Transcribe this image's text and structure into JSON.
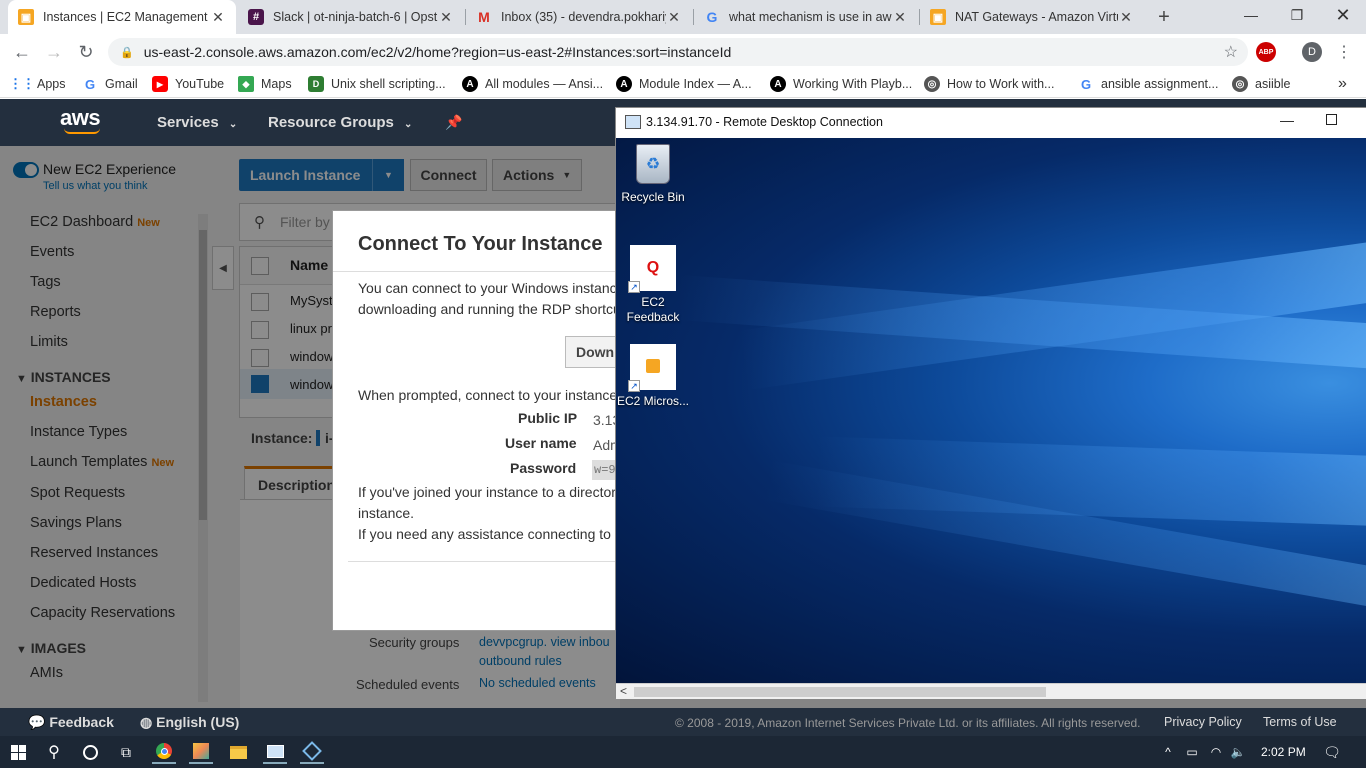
{
  "browser": {
    "tabs": [
      {
        "title": "Instances | EC2 Management C",
        "active": true
      },
      {
        "title": "Slack | ot-ninja-batch-6 | Opst",
        "active": false
      },
      {
        "title": "Inbox (35) - devendra.pokhariy",
        "active": false
      },
      {
        "title": "what mechanism is use in aws",
        "active": false
      },
      {
        "title": "NAT Gateways - Amazon Virtu",
        "active": false
      }
    ],
    "new_tab": "+",
    "url": "us-east-2.console.aws.amazon.com/ec2/v2/home?region=us-east-2#Instances:sort=instanceId",
    "profile_initial": "D",
    "abp": "ABP",
    "bookmarks": [
      "Apps",
      "Gmail",
      "YouTube",
      "Maps",
      "Unix shell scripting...",
      "All modules — Ansi...",
      "Module Index — A...",
      "Working With Playb...",
      "How to Work with...",
      "ansible assignment...",
      "asiible"
    ],
    "more": "»"
  },
  "aws": {
    "logo": "aws",
    "nav": {
      "services": "Services",
      "resource_groups": "Resource Groups"
    },
    "toggle": {
      "label": "New EC2 Experience",
      "sub": "Tell us what you think"
    },
    "sidebar": [
      {
        "label": "EC2 Dashboard",
        "badge": "New"
      },
      {
        "label": "Events"
      },
      {
        "label": "Tags"
      },
      {
        "label": "Reports"
      },
      {
        "label": "Limits"
      }
    ],
    "section_instances": "INSTANCES",
    "instances_items": [
      {
        "label": "Instances",
        "active": true
      },
      {
        "label": "Instance Types"
      },
      {
        "label": "Launch Templates",
        "badge": "New"
      },
      {
        "label": "Spot Requests"
      },
      {
        "label": "Savings Plans"
      },
      {
        "label": "Reserved Instances"
      },
      {
        "label": "Dedicated Hosts"
      },
      {
        "label": "Capacity Reservations"
      }
    ],
    "section_images": "IMAGES",
    "images_items": [
      "AMIs"
    ],
    "toolbar": {
      "launch": "Launch Instance",
      "connect": "Connect",
      "actions": "Actions"
    },
    "filter_placeholder": "Filter by t",
    "table": {
      "header": "Name",
      "rows": [
        "MySyst",
        "linux pr",
        "window",
        "window"
      ]
    },
    "instance_label": "Instance:",
    "instance_value": "i-",
    "tab_description": "Description",
    "details": [
      {
        "key": "Security groups",
        "value": "devvpcgrup. view inbou",
        "value2": "outbound rules"
      },
      {
        "key": "Scheduled events",
        "value": "No scheduled events"
      }
    ],
    "footer": {
      "feedback": "Feedback",
      "language": "English (US)",
      "copyright": "© 2008 - 2019, Amazon Internet Services Private Ltd. or its affiliates. All rights reserved.",
      "privacy": "Privacy Policy",
      "terms": "Terms of Use"
    }
  },
  "modal": {
    "title": "Connect To Your Instance",
    "intro1": "You can connect to your Windows instanc",
    "intro2": "downloading and running the RDP shortcu",
    "download_button": "Down",
    "prompt": "When prompted, connect to your instance",
    "fields": [
      {
        "label": "Public IP",
        "value": "3.13"
      },
      {
        "label": "User name",
        "value": "Adm"
      },
      {
        "label": "Password",
        "value": "w=9"
      }
    ],
    "note1": "If you've joined your instance to a director",
    "note2": "instance.",
    "note3": "If you need any assistance connecting to"
  },
  "rdp": {
    "title": "3.134.91.70 - Remote Desktop Connection",
    "icons": [
      {
        "label": "Recycle Bin"
      },
      {
        "label": "EC2 Feedback",
        "glyph": "Q"
      },
      {
        "label": "EC2 Micros..."
      }
    ],
    "scroll_left": "<"
  },
  "taskbar": {
    "time": "2:02 PM"
  }
}
